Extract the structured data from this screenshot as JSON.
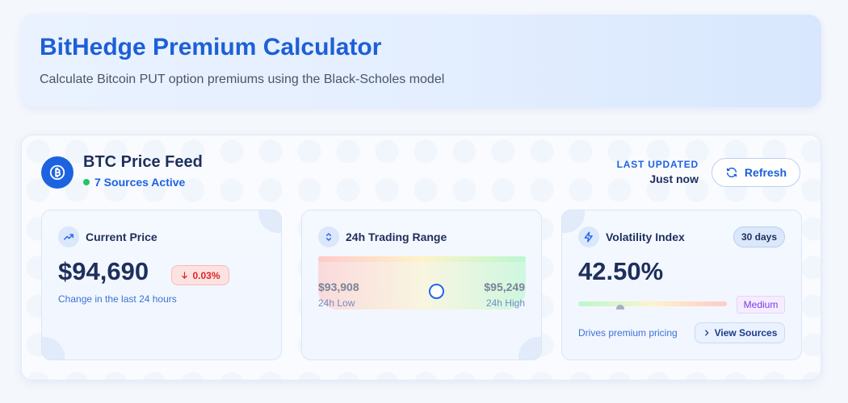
{
  "header": {
    "title": "BitHedge Premium Calculator",
    "subtitle": "Calculate Bitcoin PUT option premiums using the Black-Scholes model"
  },
  "feed": {
    "title": "BTC Price Feed",
    "status": "7 Sources Active",
    "updated_label": "LAST UPDATED",
    "updated_value": "Just now",
    "refresh_label": "Refresh",
    "icon": "bitcoin-icon"
  },
  "current_price": {
    "title": "Current Price",
    "value": "$94,690",
    "change": "0.03%",
    "change_direction": "down",
    "caption": "Change in the last 24 hours",
    "icon": "trending-up-icon"
  },
  "trading_range": {
    "title": "24h Trading Range",
    "low_value": "$93,908",
    "low_label": "24h Low",
    "high_value": "$95,249",
    "high_label": "24h High",
    "marker_fraction": 0.57,
    "icon": "chevrons-up-down-icon"
  },
  "volatility": {
    "title": "Volatility Index",
    "period": "30 days",
    "value": "42.50%",
    "level": "Medium",
    "level_fraction": 0.28,
    "caption": "Drives premium pricing",
    "view_sources_label": "View Sources",
    "icon": "lightning-icon"
  },
  "colors": {
    "accent": "#1d63e0",
    "status_green": "#22c55e",
    "negative": "#dc2626",
    "level_purple": "#7c3aed"
  }
}
